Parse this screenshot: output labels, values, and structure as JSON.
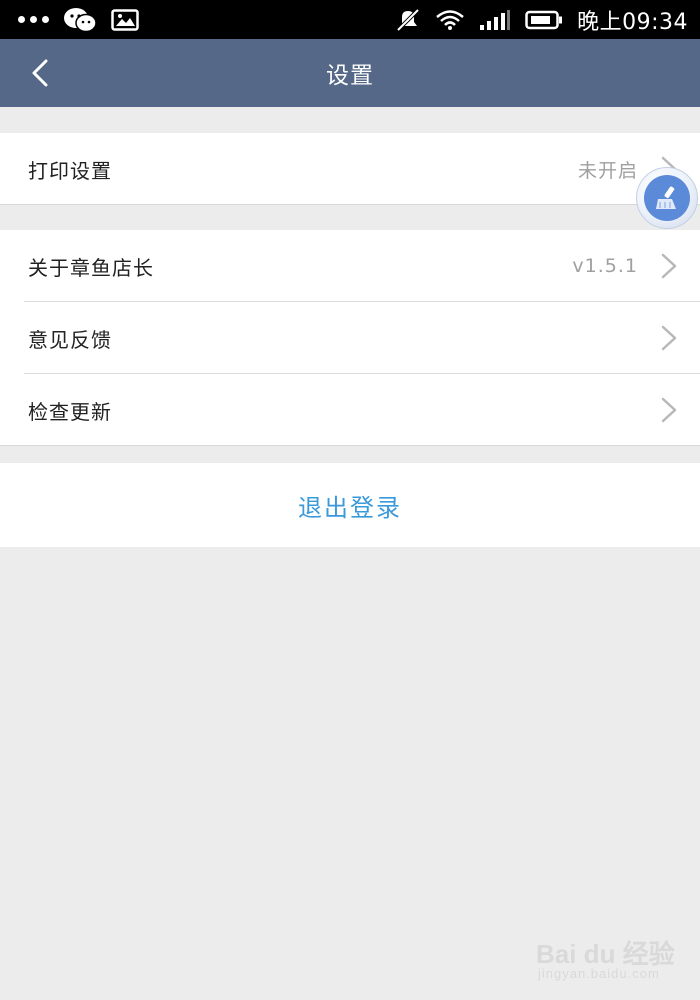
{
  "status_bar": {
    "time": "晚上09:34",
    "icons": [
      "more-dots-icon",
      "wechat-icon",
      "image-icon",
      "mute-icon",
      "wifi-icon",
      "signal-icon",
      "battery-icon"
    ]
  },
  "nav": {
    "title": "设置",
    "back_icon": "chevron-left-icon"
  },
  "group1": {
    "items": [
      {
        "label": "打印设置",
        "value": "未开启"
      }
    ]
  },
  "group2": {
    "items": [
      {
        "label": "关于章鱼店长",
        "value": "v1.5.1"
      },
      {
        "label": "意见反馈"
      },
      {
        "label": "检查更新"
      }
    ]
  },
  "logout": {
    "label": "退出登录"
  },
  "watermark": {
    "main": "Bai du 经验",
    "sub": "jingyan.baidu.com"
  },
  "colors": {
    "nav_bg": "#556887",
    "page_bg": "#ececec",
    "accent": "#3a9ad9",
    "float_btn": "#5b8ad8"
  }
}
